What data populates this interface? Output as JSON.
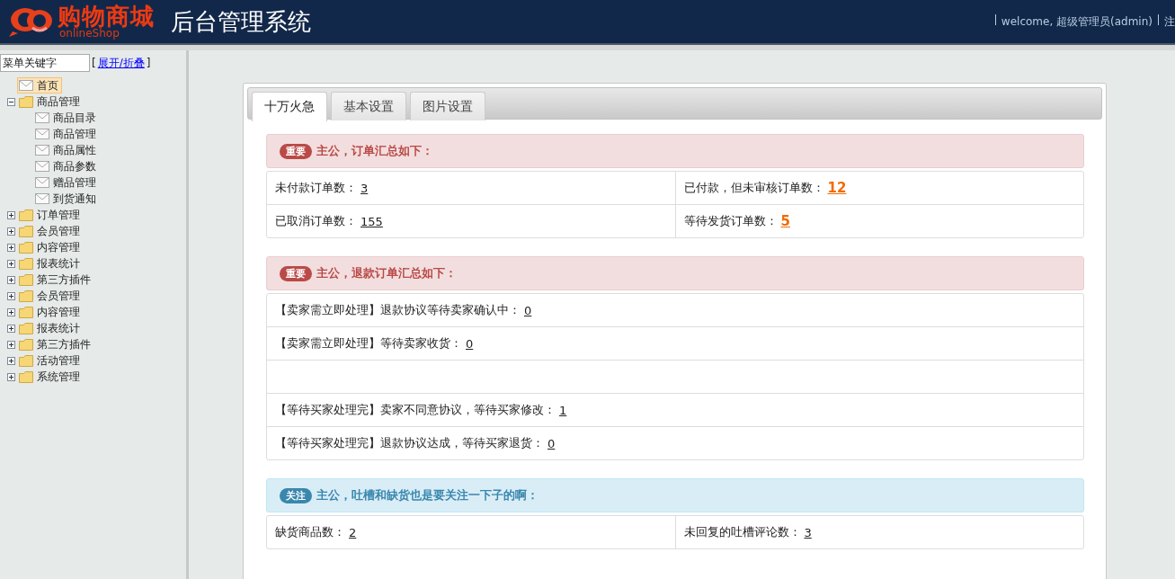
{
  "header": {
    "logo_text": "购物商城",
    "logo_subtext": "onlineShop",
    "title": "后台管理系统",
    "welcome": "welcome, 超级管理员(admin)",
    "logout": "注"
  },
  "sidebar": {
    "search": {
      "placeholder": "菜单关键字"
    },
    "bracket_open": "[",
    "toggle_link": "展开/折叠",
    "bracket_close": "]",
    "tree": [
      {
        "label": "首页",
        "kind": "page",
        "selected": true
      },
      {
        "label": "商品管理",
        "kind": "folder",
        "expanded": true,
        "selected": false,
        "children": [
          {
            "label": "商品目录",
            "kind": "page",
            "selected": false
          },
          {
            "label": "商品管理",
            "kind": "page",
            "selected": false
          },
          {
            "label": "商品属性",
            "kind": "page",
            "selected": false
          },
          {
            "label": "商品参数",
            "kind": "page",
            "selected": false
          },
          {
            "label": "赠品管理",
            "kind": "page",
            "selected": false
          },
          {
            "label": "到货通知",
            "kind": "page",
            "selected": false
          }
        ]
      },
      {
        "label": "订单管理",
        "kind": "folder",
        "expanded": false,
        "selected": false
      },
      {
        "label": "会员管理",
        "kind": "folder",
        "expanded": false,
        "selected": false
      },
      {
        "label": "内容管理",
        "kind": "folder",
        "expanded": false,
        "selected": false
      },
      {
        "label": "报表统计",
        "kind": "folder",
        "expanded": false,
        "selected": false
      },
      {
        "label": "第三方插件",
        "kind": "folder",
        "expanded": false,
        "selected": false
      },
      {
        "label": "会员管理",
        "kind": "folder",
        "expanded": false,
        "selected": false
      },
      {
        "label": "内容管理",
        "kind": "folder",
        "expanded": false,
        "selected": false
      },
      {
        "label": "报表统计",
        "kind": "folder",
        "expanded": false,
        "selected": false
      },
      {
        "label": "第三方插件",
        "kind": "folder",
        "expanded": false,
        "selected": false
      },
      {
        "label": "活动管理",
        "kind": "folder",
        "expanded": false,
        "selected": false
      },
      {
        "label": "系统管理",
        "kind": "folder",
        "expanded": false,
        "selected": false
      }
    ]
  },
  "tabs": [
    {
      "label": "十万火急",
      "selected": true
    },
    {
      "label": "基本设置",
      "selected": false
    },
    {
      "label": "图片设置",
      "selected": false
    }
  ],
  "sections": [
    {
      "kind": "important",
      "badge": "重要",
      "heading": "主公，订单汇总如下：",
      "rows": [
        [
          {
            "label": "未付款订单数：",
            "value": "3",
            "highlight": false
          },
          {
            "label": "已付款，但未审核订单数：",
            "value": "12",
            "highlight": true
          }
        ],
        [
          {
            "label": "已取消订单数：",
            "value": "155",
            "highlight": false
          },
          {
            "label": "等待发货订单数：",
            "value": "5",
            "highlight": true
          }
        ]
      ]
    },
    {
      "kind": "important",
      "badge": "重要",
      "heading": "主公，退款订单汇总如下：",
      "rows": [
        [
          {
            "label": "【卖家需立即处理】退款协议等待卖家确认中：",
            "value": "0",
            "highlight": false
          }
        ],
        [
          {
            "label": "【卖家需立即处理】等待卖家收货：",
            "value": "0",
            "highlight": false
          }
        ],
        [],
        [
          {
            "label": "【等待买家处理完】卖家不同意协议，等待买家修改：",
            "value": "1",
            "highlight": false
          }
        ],
        [
          {
            "label": "【等待买家处理完】退款协议达成，等待买家退货：",
            "value": "0",
            "highlight": false
          }
        ]
      ]
    },
    {
      "kind": "notice",
      "badge": "关注",
      "heading": "主公，吐槽和缺货也是要关注一下子的啊：",
      "rows": [
        [
          {
            "label": "缺货商品数：",
            "value": "2",
            "highlight": false
          },
          {
            "label": "未回复的吐槽评论数：",
            "value": "3",
            "highlight": false
          }
        ]
      ]
    }
  ]
}
